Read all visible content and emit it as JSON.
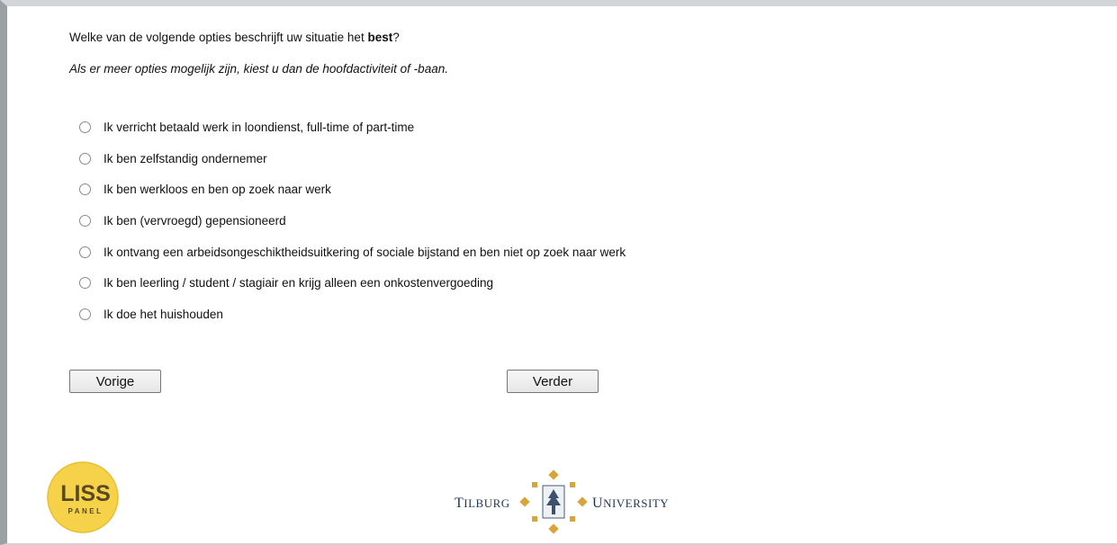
{
  "question": {
    "text_before": "Welke van de volgende opties beschrijft uw situatie het ",
    "text_bold": "best",
    "text_after": "?",
    "instruction": "Als er meer opties mogelijk zijn, kiest u dan de hoofdactiviteit of -baan."
  },
  "options": [
    {
      "label": "Ik verricht betaald werk in loondienst, full-time of part-time",
      "selected": false
    },
    {
      "label": "Ik ben zelfstandig ondernemer",
      "selected": false
    },
    {
      "label": "Ik ben werkloos en ben op zoek naar werk",
      "selected": false
    },
    {
      "label": "Ik ben (vervroegd) gepensioneerd",
      "selected": false
    },
    {
      "label": "Ik ontvang een arbeidsongeschiktheidsuitkering of sociale bijstand en ben niet op zoek naar werk",
      "selected": false
    },
    {
      "label": "Ik ben leerling / student / stagiair en krijg alleen een onkostenvergoeding",
      "selected": false
    },
    {
      "label": "Ik doe het huishouden",
      "selected": false
    }
  ],
  "buttons": {
    "previous": "Vorige",
    "next": "Verder"
  },
  "logos": {
    "liss_line1": "LISS",
    "liss_line2": "PANEL",
    "tilburg_left_initial": "T",
    "tilburg_left_rest": "ILBURG",
    "tilburg_right_initial": "U",
    "tilburg_right_rest": "NIVERSITY"
  },
  "colors": {
    "liss_yellow": "#f5d24a",
    "liss_text": "#5a4a1f",
    "tilburg_blue": "#1d3557",
    "tilburg_gold": "#d8a53a"
  }
}
